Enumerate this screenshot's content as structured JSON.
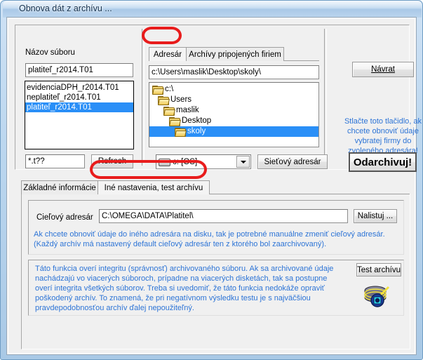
{
  "window": {
    "title": "Obnova dát z archívu ...",
    "colors": {
      "frame": "#a9c9e6",
      "client": "#f0f0f0",
      "selection": "#2a8ff7",
      "hint_text": "#2d74d6",
      "annotation": "#e81c1c"
    }
  },
  "file_panel": {
    "group_label": "Názov súboru",
    "filename_value": "platiteľ_r2014.T01",
    "files": [
      {
        "name": "evidenciaDPH_r2014.T01",
        "selected": false
      },
      {
        "name": "neplatiteľ_r2014.T01",
        "selected": false
      },
      {
        "name": "platiteľ_r2014.T01",
        "selected": true
      }
    ],
    "mask_value": "*.t??",
    "refresh_label": "Refresh"
  },
  "dir_panel": {
    "tabs": [
      {
        "label": "Adresár",
        "active": true,
        "annotated": true
      },
      {
        "label": "Archívy pripojených firiem",
        "active": false,
        "annotated": false
      }
    ],
    "path_value": "c:\\Users\\maslik\\Desktop\\skoly\\",
    "tree": [
      {
        "label": "c:\\",
        "depth": 0,
        "selected": false
      },
      {
        "label": "Users",
        "depth": 1,
        "selected": false
      },
      {
        "label": "maslik",
        "depth": 2,
        "selected": false
      },
      {
        "label": "Desktop",
        "depth": 3,
        "selected": false
      },
      {
        "label": "skoly",
        "depth": 4,
        "selected": true
      }
    ],
    "drive_value": "c: [OS]",
    "network_button": "Sieťový adresár"
  },
  "action_panel": {
    "back_button": "Návrat",
    "hint_lines": [
      "Stlačte toto tlačidlo, ak",
      "chcete obnoviť údaje",
      "vybratej firmy do",
      "zvoleného adresára!"
    ],
    "unarchive_button": "Odarchivuj!"
  },
  "bottom": {
    "tabs": [
      {
        "label": "Základné informácie",
        "active": false,
        "annotated": false
      },
      {
        "label": "Iné nastavenia, test archívu",
        "active": true,
        "annotated": true
      }
    ],
    "target_dir_label": "Cieľový adresár",
    "target_dir_value": "C:\\OMEGA\\DATA\\Platitel\\",
    "browse_button": "Nalistuj ...",
    "target_hint": "Ak chcete obnoviť údaje do iného adresára na disku, tak je potrebné manuálne zmeniť cieľový adresár. (Každý archív má nastavený default cieľový adresár ten z ktorého bol zaarchivovaný).",
    "test_info": "Táto funkcia overí integritu (správnosť) archivovaného súboru. Ak sa archivované údaje nachádzajú vo viacerých súboroch, prípadne na viacerých disketách, tak sa  postupne overí integrita všetkých súborov. Treba si uvedomiť, že táto funkcia nedokáže opraviť poškodený archív. To znamená, že pri negatívnom výsledku testu je s najväčšiou pravdepodobnosťou archív ďalej nepoužiteľný.",
    "test_button": "Test archívu"
  }
}
